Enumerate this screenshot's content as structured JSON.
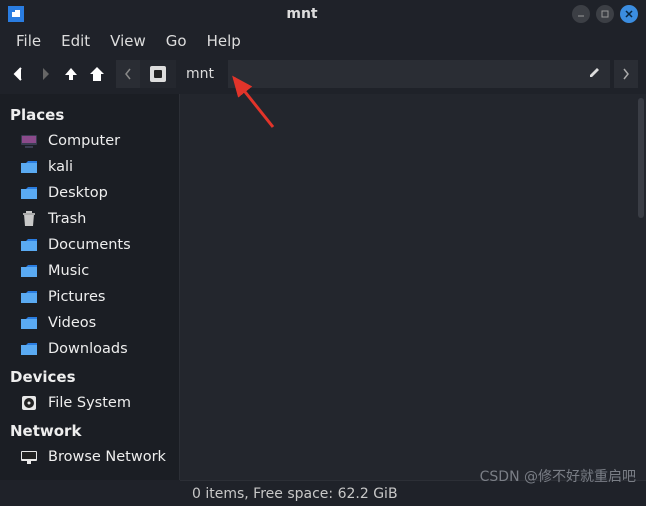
{
  "titlebar": {
    "title": "mnt"
  },
  "menubar": {
    "file": "File",
    "edit": "Edit",
    "view": "View",
    "go": "Go",
    "help": "Help"
  },
  "toolbar": {
    "breadcrumb_root_icon": "device-icon",
    "breadcrumb_label": "mnt"
  },
  "sidebar": {
    "places_header": "Places",
    "places": [
      {
        "label": "Computer",
        "icon": "computer-icon"
      },
      {
        "label": "kali",
        "icon": "folder-icon"
      },
      {
        "label": "Desktop",
        "icon": "folder-icon"
      },
      {
        "label": "Trash",
        "icon": "trash-icon"
      },
      {
        "label": "Documents",
        "icon": "folder-icon"
      },
      {
        "label": "Music",
        "icon": "folder-icon"
      },
      {
        "label": "Pictures",
        "icon": "folder-icon"
      },
      {
        "label": "Videos",
        "icon": "folder-icon"
      },
      {
        "label": "Downloads",
        "icon": "folder-icon"
      }
    ],
    "devices_header": "Devices",
    "devices": [
      {
        "label": "File System",
        "icon": "disk-icon"
      }
    ],
    "network_header": "Network",
    "network": [
      {
        "label": "Browse Network",
        "icon": "network-icon"
      }
    ]
  },
  "statusbar": {
    "text": "0 items, Free space: 62.2 GiB"
  },
  "watermark": "CSDN @修不好就重启吧"
}
